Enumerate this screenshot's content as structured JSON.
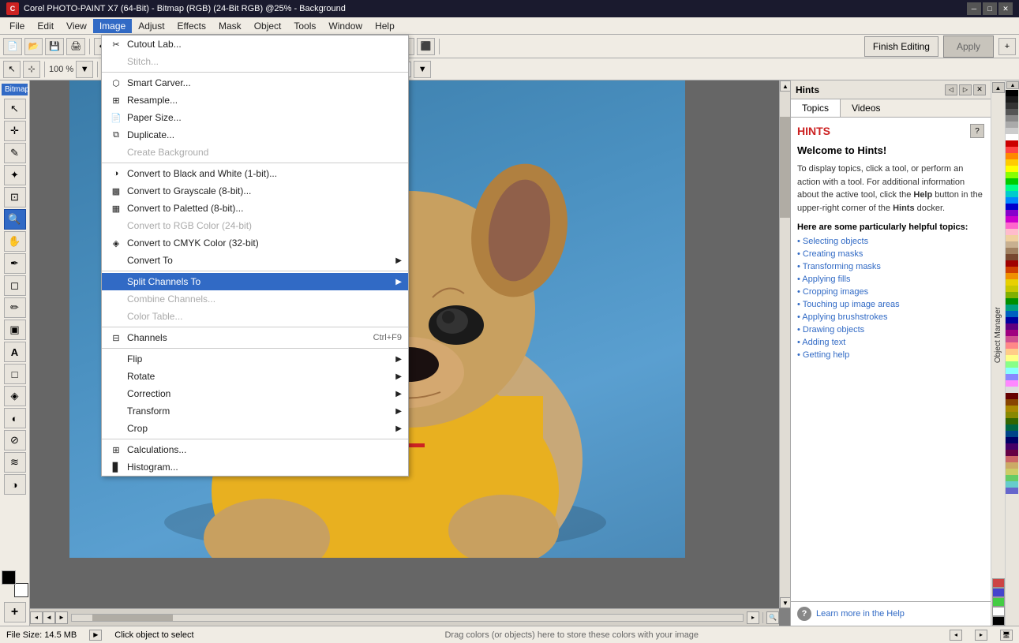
{
  "titleBar": {
    "text": "Corel PHOTO-PAINT X7 (64-Bit) - Bitmap (RGB) (24-Bit RGB) @25% - Background",
    "icon": "C"
  },
  "menuBar": {
    "items": [
      "File",
      "Edit",
      "View",
      "Image",
      "Adjust",
      "Effects",
      "Mask",
      "Object",
      "Tools",
      "Window",
      "Help"
    ]
  },
  "toolbar": {
    "zoom": "25%",
    "finishEditing": "Finish Editing",
    "apply": "Apply"
  },
  "toolbox": {
    "tools": [
      {
        "name": "cursor",
        "icon": "↖",
        "label": "cursor-tool"
      },
      {
        "name": "mask-transform",
        "icon": "⊹",
        "label": "mask-transform"
      },
      {
        "name": "freehand-mask",
        "icon": "✎",
        "label": "freehand-mask"
      },
      {
        "name": "magic-wand",
        "icon": "✦",
        "label": "magic-wand"
      },
      {
        "name": "crop",
        "icon": "⊡",
        "label": "crop-tool"
      },
      {
        "name": "zoom",
        "icon": "⊕",
        "label": "zoom-tool"
      },
      {
        "name": "pan",
        "icon": "✋",
        "label": "pan-tool"
      },
      {
        "name": "eyedropper",
        "icon": "✒",
        "label": "eyedropper"
      },
      {
        "name": "eraser",
        "icon": "◻",
        "label": "eraser"
      },
      {
        "name": "paintbrush",
        "icon": "✏",
        "label": "paintbrush"
      },
      {
        "name": "fill",
        "icon": "▣",
        "label": "fill-tool"
      },
      {
        "name": "text",
        "icon": "A",
        "label": "text-tool"
      },
      {
        "name": "rectangle",
        "icon": "□",
        "label": "rectangle-tool"
      },
      {
        "name": "blend",
        "icon": "◈",
        "label": "blend-tool"
      },
      {
        "name": "shadow",
        "icon": "◐",
        "label": "shadow-tool"
      },
      {
        "name": "color-eyedropper",
        "icon": "⊘",
        "label": "color-eyedropper"
      },
      {
        "name": "smear",
        "icon": "≋",
        "label": "smear-tool"
      },
      {
        "name": "dodge",
        "icon": "◑",
        "label": "dodge-tool"
      }
    ],
    "bitmapLabel": "Bitmap (RGB)"
  },
  "dropdown": {
    "title": "Image",
    "items": [
      {
        "label": "Cutout Lab...",
        "icon": "scissors",
        "enabled": true,
        "hasIcon": true
      },
      {
        "label": "Stitch...",
        "icon": "",
        "enabled": false,
        "hasIcon": false
      },
      {
        "separator": true
      },
      {
        "label": "Smart Carver...",
        "icon": "smart",
        "enabled": true,
        "hasIcon": true
      },
      {
        "label": "Resample...",
        "icon": "resample",
        "enabled": true,
        "hasIcon": true
      },
      {
        "label": "Paper Size...",
        "icon": "paper",
        "enabled": true,
        "hasIcon": true
      },
      {
        "label": "Duplicate...",
        "icon": "duplicate",
        "enabled": true,
        "hasIcon": true
      },
      {
        "label": "Create Background",
        "icon": "",
        "enabled": false,
        "hasIcon": false
      },
      {
        "separator": true
      },
      {
        "label": "Convert to Black and White (1-bit)...",
        "icon": "bw",
        "enabled": true,
        "hasIcon": true
      },
      {
        "label": "Convert to Grayscale (8-bit)...",
        "icon": "gray",
        "enabled": true,
        "hasIcon": true
      },
      {
        "label": "Convert to Paletted (8-bit)...",
        "icon": "palette",
        "enabled": true,
        "hasIcon": true
      },
      {
        "label": "Convert to RGB Color (24-bit)",
        "icon": "",
        "enabled": false,
        "hasIcon": false
      },
      {
        "label": "Convert to CMYK Color (32-bit)",
        "icon": "cmyk",
        "enabled": true,
        "hasIcon": true
      },
      {
        "label": "Convert To",
        "icon": "",
        "enabled": true,
        "hasIcon": false,
        "hasArrow": true
      },
      {
        "separator": true
      },
      {
        "label": "Split Channels To",
        "icon": "",
        "enabled": true,
        "hasIcon": false,
        "hasArrow": true,
        "active": true
      },
      {
        "label": "Combine Channels...",
        "icon": "",
        "enabled": false,
        "hasIcon": false
      },
      {
        "label": "Color Table...",
        "icon": "",
        "enabled": false,
        "hasIcon": false
      },
      {
        "separator": true
      },
      {
        "label": "Channels",
        "icon": "channels",
        "enabled": true,
        "hasIcon": true,
        "shortcut": "Ctrl+F9"
      },
      {
        "separator": true
      },
      {
        "label": "Flip",
        "icon": "",
        "enabled": true,
        "hasIcon": false,
        "hasArrow": true
      },
      {
        "label": "Rotate",
        "icon": "",
        "enabled": true,
        "hasIcon": false,
        "hasArrow": true
      },
      {
        "label": "Correction",
        "icon": "",
        "enabled": true,
        "hasIcon": false,
        "hasArrow": true
      },
      {
        "label": "Transform",
        "icon": "",
        "enabled": true,
        "hasIcon": false,
        "hasArrow": true
      },
      {
        "label": "Crop",
        "icon": "",
        "enabled": true,
        "hasIcon": false,
        "hasArrow": true
      },
      {
        "separator": true
      },
      {
        "label": "Calculations...",
        "icon": "calc",
        "enabled": true,
        "hasIcon": true
      },
      {
        "label": "Histogram...",
        "icon": "hist",
        "enabled": true,
        "hasIcon": true
      }
    ]
  },
  "hints": {
    "title": "Hints",
    "tabs": [
      "Topics",
      "Videos"
    ],
    "activeTab": "Topics",
    "section": "HINTS",
    "welcome": "Welcome to Hints!",
    "description": "To display topics, click a tool, or perform an action with a tool. For additional information about the active tool, click the Help button in the upper-right corner of the Hints docker.",
    "subtitle": "Here are some particularly helpful topics:",
    "links": [
      "Selecting objects",
      "Creating masks",
      "Transforming masks",
      "Applying fills",
      "Cropping images",
      "Touching up image areas",
      "Applying brushstrokes",
      "Drawing objects",
      "Adding text",
      "Getting help"
    ],
    "footerLink": "Learn more in the Help",
    "helpIconLabel": "?"
  },
  "statusBar": {
    "fileSize": "File Size: 14.5 MB",
    "instruction": "Click object to select",
    "colorInstruction": "Drag colors (or objects) here to store these colors with your image"
  },
  "colors": {
    "accent": "#316ac5",
    "menuBg": "#f0ece4",
    "disabled": "#aaa",
    "activeMenuBg": "#316ac5",
    "hintsRed": "#cc2222"
  },
  "paletteColors": [
    "#000000",
    "#1a1a1a",
    "#333333",
    "#555555",
    "#888888",
    "#aaaaaa",
    "#cccccc",
    "#ffffff",
    "#cc0000",
    "#ff4444",
    "#ff8800",
    "#ffcc00",
    "#ffff00",
    "#88ff00",
    "#00cc00",
    "#00ff88",
    "#00cccc",
    "#0088ff",
    "#0000cc",
    "#8800cc",
    "#cc00cc",
    "#ff66cc",
    "#ffbbcc",
    "#f0d0a0",
    "#c8b090",
    "#a08060",
    "#784830",
    "#a00000",
    "#d04000",
    "#f09000",
    "#e8d000",
    "#c8c800",
    "#80b000",
    "#009000",
    "#00a080",
    "#0060c0",
    "#0000a0",
    "#600080",
    "#a00080",
    "#d05090",
    "#ff8888",
    "#ffcc88",
    "#ffff88",
    "#88ff88",
    "#88ffff",
    "#8888ff",
    "#ff88ff",
    "#dddddd",
    "#660000",
    "#884400",
    "#aa8800",
    "#888800",
    "#336600",
    "#006644",
    "#004488",
    "#000066",
    "#440066",
    "#660044",
    "#cc6666",
    "#ccaa66",
    "#cccc66",
    "#66cc66",
    "#66cccc",
    "#6666cc"
  ]
}
